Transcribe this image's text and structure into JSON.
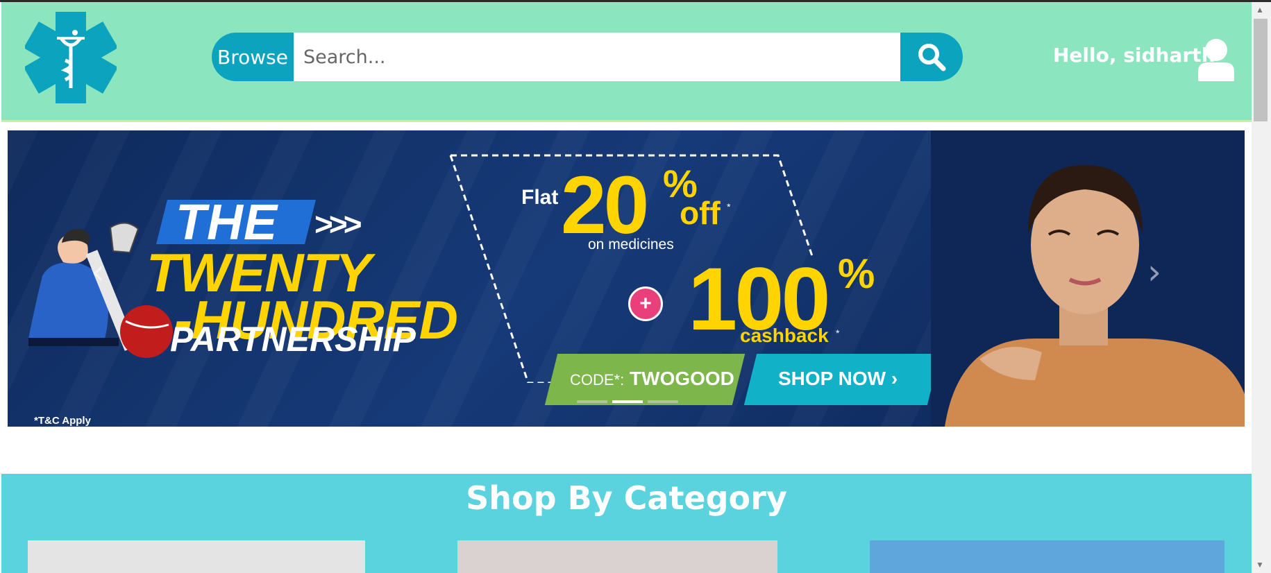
{
  "header": {
    "browse_label": "Browse",
    "search_placeholder": "Search...",
    "greeting": "Hello, sidharth"
  },
  "banner": {
    "the": "THE",
    "chevrons": ">>>",
    "twenty": "TWENTY",
    "hundred": "-HUNDRED",
    "partnership": "PARTNERSHIP",
    "tc": "*T&C Apply",
    "flat": "Flat",
    "twenty_pct": "20",
    "pct_sign": "%",
    "off": "off",
    "star": "*",
    "on_medicines": "on medicines",
    "plus": "+",
    "hundred_pct": "100",
    "cashback": "cashback",
    "code_label": "CODE*:",
    "code_value": "TWOGOOD",
    "shop_now": "SHOP NOW",
    "shop_arrow": "›",
    "prev_arrow": "‹",
    "next_arrow": "›",
    "active_slide": 2,
    "slide_count": 3
  },
  "category": {
    "title": "Shop By Category"
  },
  "colors": {
    "header_bg": "#8be6c0",
    "accent": "#0ca3bf",
    "category_bg": "#5ad3df",
    "banner_yellow": "#ffd400"
  },
  "icons": [
    "medical-star-logo-icon",
    "search-icon",
    "user-icon",
    "chevron-left-icon",
    "chevron-right-icon"
  ]
}
